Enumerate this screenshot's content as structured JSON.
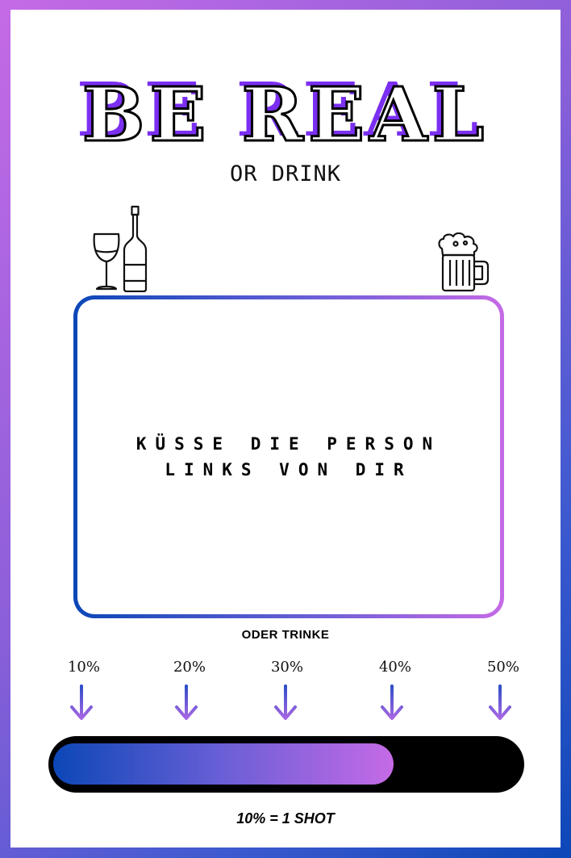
{
  "header": {
    "title": "BE REAL",
    "subtitle": "OR DRINK"
  },
  "icons": {
    "left": "wine-glass-and-bottle-icon",
    "right": "beer-mug-icon"
  },
  "task": {
    "text": "KÜSSE DIE PERSON LINKS VON DIR"
  },
  "drink": {
    "label": "ODER TRINKE",
    "percentages": [
      "10%",
      "20%",
      "30%",
      "40%",
      "50%"
    ],
    "progress": 0.73,
    "footer": "10% = 1 SHOT"
  },
  "colors": {
    "accent_purple": "#7b2ff0",
    "gradient_start": "#0c47b7",
    "gradient_end": "#c56ae6"
  }
}
